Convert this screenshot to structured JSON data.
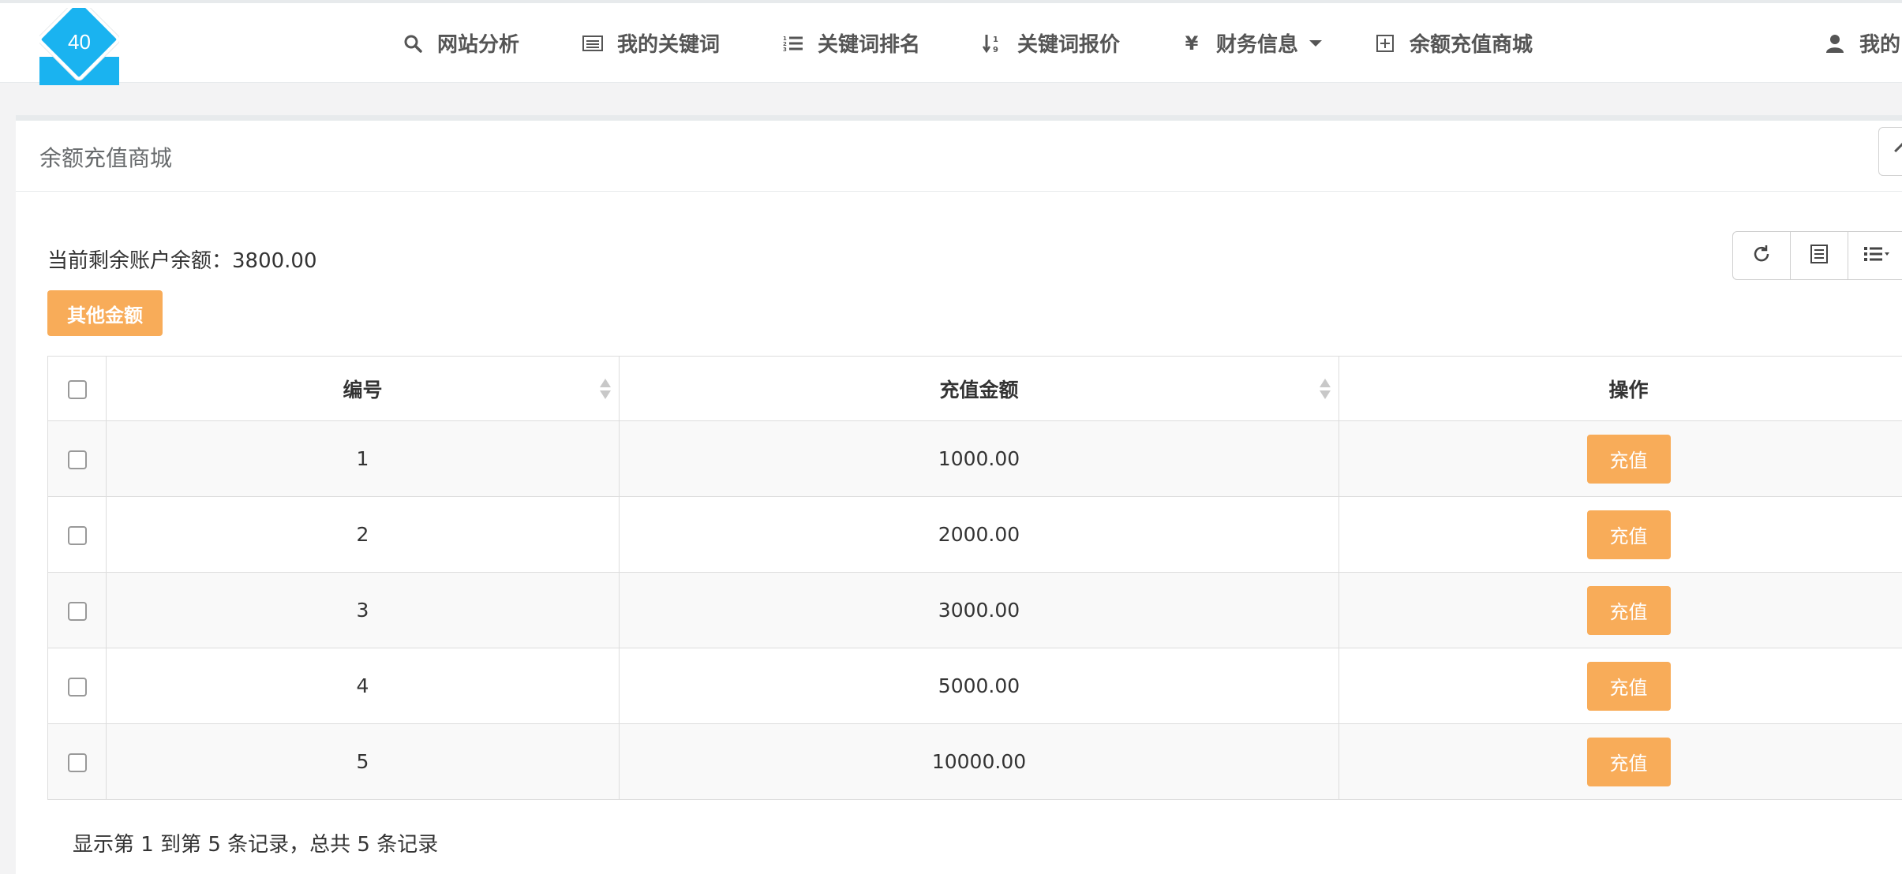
{
  "logo": {
    "number": "40"
  },
  "nav": {
    "items": [
      {
        "label": "网站分析",
        "icon": "search-icon"
      },
      {
        "label": "我的关键词",
        "icon": "list-alt-icon"
      },
      {
        "label": "关键词排名",
        "icon": "ordered-list-icon"
      },
      {
        "label": "关键词报价",
        "icon": "sort-numeric-icon"
      },
      {
        "label": "财务信息",
        "icon": "yen-icon",
        "dropdown": true
      },
      {
        "label": "余额充值商城",
        "icon": "plus-square-icon"
      }
    ],
    "user_label": "我的"
  },
  "panel": {
    "title": "余额充值商城"
  },
  "balance": {
    "label": "当前剩余账户余额：3800.00"
  },
  "other_amount_button": "其他金额",
  "toolbar": {
    "icons": [
      "refresh-icon",
      "toggle-view-icon",
      "columns-icon"
    ]
  },
  "table": {
    "headers": {
      "id": "编号",
      "amount": "充值金额",
      "action": "操作"
    },
    "rows": [
      {
        "id": "1",
        "amount": "1000.00",
        "action": "充值"
      },
      {
        "id": "2",
        "amount": "2000.00",
        "action": "充值"
      },
      {
        "id": "3",
        "amount": "3000.00",
        "action": "充值"
      },
      {
        "id": "4",
        "amount": "5000.00",
        "action": "充值"
      },
      {
        "id": "5",
        "amount": "10000.00",
        "action": "充值"
      }
    ]
  },
  "pagination": {
    "summary": "显示第 1 到第 5 条记录，总共 5 条记录"
  },
  "colors": {
    "accent": "#f8ac59",
    "logo": "#1ab3f0"
  }
}
